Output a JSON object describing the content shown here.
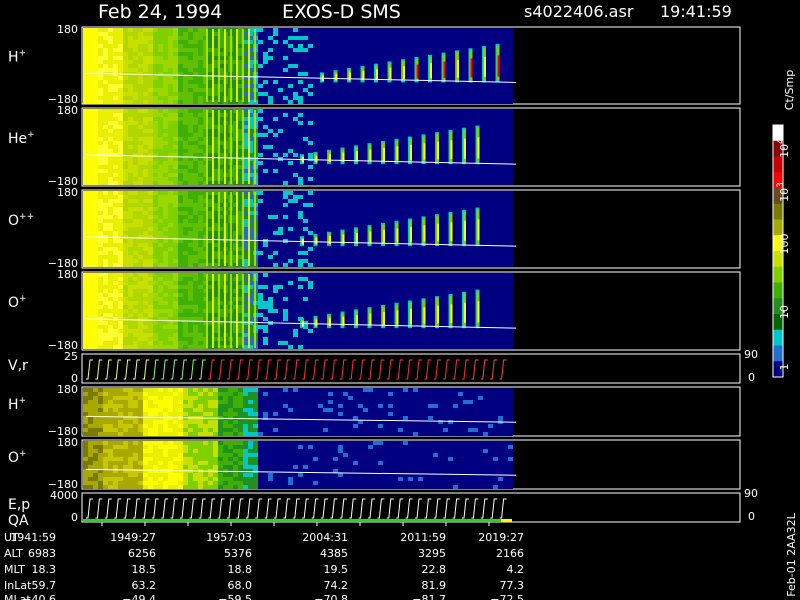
{
  "header": {
    "date": "Feb 24, 1994",
    "instrument": "EXOS-D SMS",
    "file": "s4022406.asr",
    "time": "19:41:59"
  },
  "chart_data": {
    "type": "heatmap",
    "panels": [
      {
        "label": "H",
        "charge": "+",
        "ymax": "180",
        "ymin": "−180",
        "kind": "spectro",
        "flow": "upper"
      },
      {
        "label": "He",
        "charge": "+",
        "ymax": "180",
        "ymin": "−180",
        "kind": "spectro",
        "flow": "upper"
      },
      {
        "label": "O",
        "charge": "++",
        "ymax": "180",
        "ymin": "−180",
        "kind": "spectro",
        "flow": "upper"
      },
      {
        "label": "O",
        "charge": "+",
        "ymax": "180",
        "ymin": "−180",
        "kind": "spectro",
        "flow": "upper"
      },
      {
        "label": "V,r",
        "charge": "",
        "ymax": "25",
        "ymin": "0",
        "kind": "sweep",
        "right_top": "90",
        "right_bottom": "0"
      },
      {
        "label": "H",
        "charge": "+",
        "ymax": "180",
        "ymin": "−180",
        "kind": "spectro",
        "flow": "lower"
      },
      {
        "label": "O",
        "charge": "+",
        "ymax": "180",
        "ymin": "−180",
        "kind": "spectro",
        "flow": "lower"
      },
      {
        "label": "E,p",
        "label2": "QA",
        "charge": "",
        "ymax": "4000",
        "ymin": "0",
        "kind": "sweep",
        "right_top": "90",
        "right_bottom": "0"
      }
    ],
    "colorbar": {
      "unit": "Ct/Smp",
      "ticks": [
        {
          "base": "10",
          "exp": "4"
        },
        {
          "base": "10",
          "exp": "3"
        },
        {
          "base": "100",
          "exp": ""
        },
        {
          "base": "10",
          "exp": ""
        },
        {
          "base": "1",
          "exp": ""
        }
      ],
      "colors": [
        "#ffffff",
        "#8b0000",
        "#c80000",
        "#ff0000",
        "#6b4b1e",
        "#7a7a00",
        "#a8a800",
        "#ffff00",
        "#c8e000",
        "#80d000",
        "#40b000",
        "#20901e",
        "#006400",
        "#00c8c8",
        "#1e6fd0",
        "#000080"
      ]
    },
    "orbit": {
      "rows": [
        {
          "label": "UT",
          "values": [
            "1941:59",
            "1949:27",
            "1957:03",
            "2004:31",
            "2011:59",
            "2019:27"
          ]
        },
        {
          "label": "ALT",
          "values": [
            "6983",
            "6256",
            "5376",
            "4385",
            "3295",
            "2166"
          ]
        },
        {
          "label": "MLT",
          "values": [
            "18.3",
            "18.5",
            "18.8",
            "19.5",
            "22.8",
            "4.2"
          ]
        },
        {
          "label": "InLat",
          "values": [
            "59.7",
            "63.2",
            "68.0",
            "74.2",
            "81.9",
            "77.3"
          ]
        },
        {
          "label": "MLat",
          "values": [
            "−40.6",
            "−49.4",
            "−59.5",
            "−70.8",
            "−81.7",
            "−72.5"
          ]
        }
      ]
    },
    "footer_code": "Feb-01 2AA32L"
  }
}
